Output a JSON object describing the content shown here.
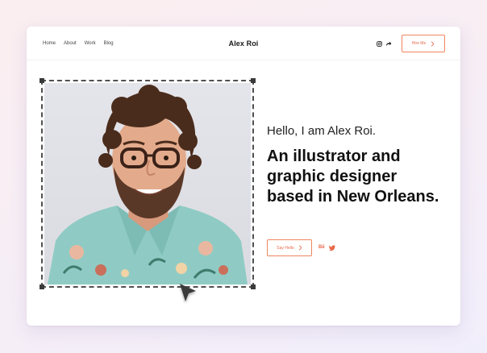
{
  "nav": {
    "links": [
      "Home",
      "About",
      "Work",
      "Blog"
    ],
    "logo": "Alex Roi",
    "social_icons": [
      "instagram-icon",
      "share-icon"
    ],
    "hire_label": "Hire Me"
  },
  "hero": {
    "greeting": "Hello, I am Alex Roi.",
    "headline": "An illustrator and graphic designer based in New Orleans.",
    "cta_label": "Say Hello",
    "social_icons": [
      "behance-icon",
      "twitter-icon"
    ],
    "behance_glyph": "Bē"
  },
  "colors": {
    "accent": "#e8694a",
    "accent_border": "#f0855f",
    "text_dark": "#111111",
    "background_card": "#ffffff"
  }
}
